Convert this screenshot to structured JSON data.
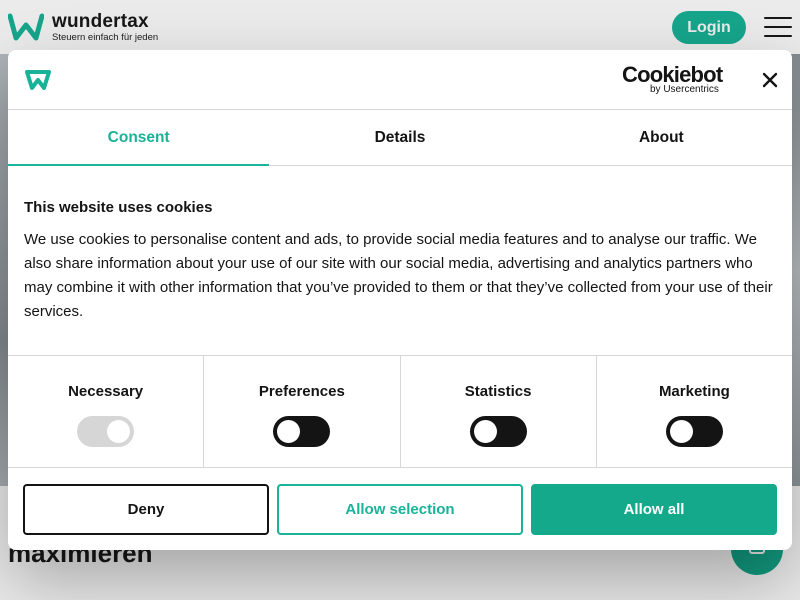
{
  "site": {
    "brand_name": "wundertax",
    "brand_tagline": "Steuern einfach für jeden",
    "login_label": "Login",
    "hero_heading": "maximieren",
    "accent_color": "#18b398"
  },
  "consent": {
    "cookiebot_logo": "Cookiebot",
    "cookiebot_byline": "by Usercentrics",
    "tabs": [
      {
        "label": "Consent",
        "active": true
      },
      {
        "label": "Details",
        "active": false
      },
      {
        "label": "About",
        "active": false
      }
    ],
    "title": "This website uses cookies",
    "body": "We use cookies to personalise content and ads, to provide social media features and to analyse our traffic. We also share information about your use of our site with our social media, advertising and analytics partners who may combine it with other information that you’ve provided to them or that they’ve collected from your use of their services.",
    "categories": [
      {
        "label": "Necessary",
        "checked": true,
        "disabled": true
      },
      {
        "label": "Preferences",
        "checked": false,
        "disabled": false
      },
      {
        "label": "Statistics",
        "checked": false,
        "disabled": false
      },
      {
        "label": "Marketing",
        "checked": false,
        "disabled": false
      }
    ],
    "buttons": {
      "deny": "Deny",
      "allow_selection": "Allow selection",
      "allow_all": "Allow all"
    }
  }
}
